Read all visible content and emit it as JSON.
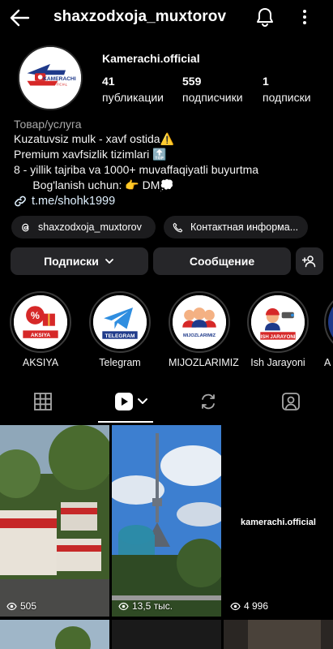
{
  "header": {
    "username": "shaxzodxoja_muxtorov"
  },
  "profile": {
    "display_name": "Kamerachi.official",
    "avatar_logo_text": "KAMERACHI",
    "avatar_logo_sub": "OFFICIAL",
    "stats": [
      {
        "value": "41",
        "label": "публикации"
      },
      {
        "value": "559",
        "label": "подписчики"
      },
      {
        "value": "1",
        "label": "подписки"
      }
    ],
    "category": "Товар/услуга",
    "bio": [
      "Kuzatuvsiz mulk - xavf ostida⚠️",
      "Premium xavfsizlik tizimlari 🔝",
      "8 - yillik tajriba va 1000+ muvaffaqiyatli buyurtma",
      "      Bog'lanish uchun: 👉 DM💭"
    ],
    "link": "t.me/shohk1999"
  },
  "chips": {
    "threads": "shaxzodxoja_muxtorov",
    "contact": "Контактная информа..."
  },
  "actions": {
    "following": "Подписки",
    "message": "Сообщение"
  },
  "highlights": [
    {
      "label": "AKSIYA",
      "cover_text": "AKSIYA"
    },
    {
      "label": "Telegram",
      "cover_text": "TELEGRAM"
    },
    {
      "label": "MIJOZLARIMIZ",
      "cover_text": "MIJOZLARIMIZ"
    },
    {
      "label": "Ish Jarayoni",
      "cover_text": "ISH JARAYONI"
    },
    {
      "label": "A"
    }
  ],
  "tabs": [
    "grid-tab",
    "reels-tab",
    "reposts-tab",
    "tagged-tab"
  ],
  "posts": [
    {
      "views": "505"
    },
    {
      "views": "13,5 тыс."
    },
    {
      "views": "4 996",
      "overlay": "kamerachi.official"
    }
  ],
  "colors": {
    "background": "#000000",
    "button": "#262629",
    "link": "#e0f1ff",
    "accent_red": "#d62828",
    "telegram_blue": "#2f8ee0"
  }
}
